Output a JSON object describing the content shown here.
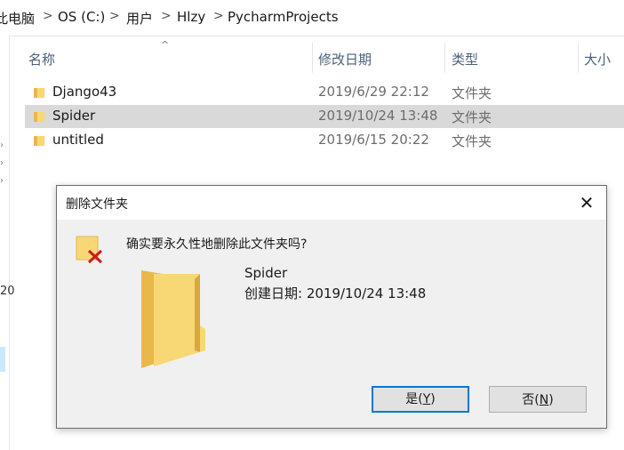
{
  "breadcrumb": {
    "items": [
      "此电脑",
      "OS (C:)",
      "用户",
      "Hlzy",
      "PycharmProjects"
    ],
    "separator": ">"
  },
  "columns": {
    "name": "名称",
    "date_modified": "修改日期",
    "type": "类型",
    "size": "大小"
  },
  "files": [
    {
      "name": "Django43",
      "date": "2019/6/29 22:12",
      "type": "文件夹",
      "selected": false
    },
    {
      "name": "Spider",
      "date": "2019/10/24 13:48",
      "type": "文件夹",
      "selected": true
    },
    {
      "name": "untitled",
      "date": "2019/6/15 20:22",
      "type": "文件夹",
      "selected": false
    }
  ],
  "navpane": {
    "partial_text": "20"
  },
  "dialog": {
    "title": "删除文件夹",
    "close_glyph": "✕",
    "question": "确实要永久性地删除此文件夹吗?",
    "folder_name": "Spider",
    "folder_created": "创建日期: 2019/10/24 13:48",
    "yes_text": "是(",
    "yes_key": "Y",
    "yes_end": ")",
    "no_text": "否(",
    "no_key": "N",
    "no_end": ")"
  },
  "colors": {
    "selection": "#d9d9d9",
    "folder": "#f8d775",
    "folder_dark": "#e8b84a",
    "delete_x": "#cc1a1a",
    "default_button_border": "#0078d7"
  }
}
